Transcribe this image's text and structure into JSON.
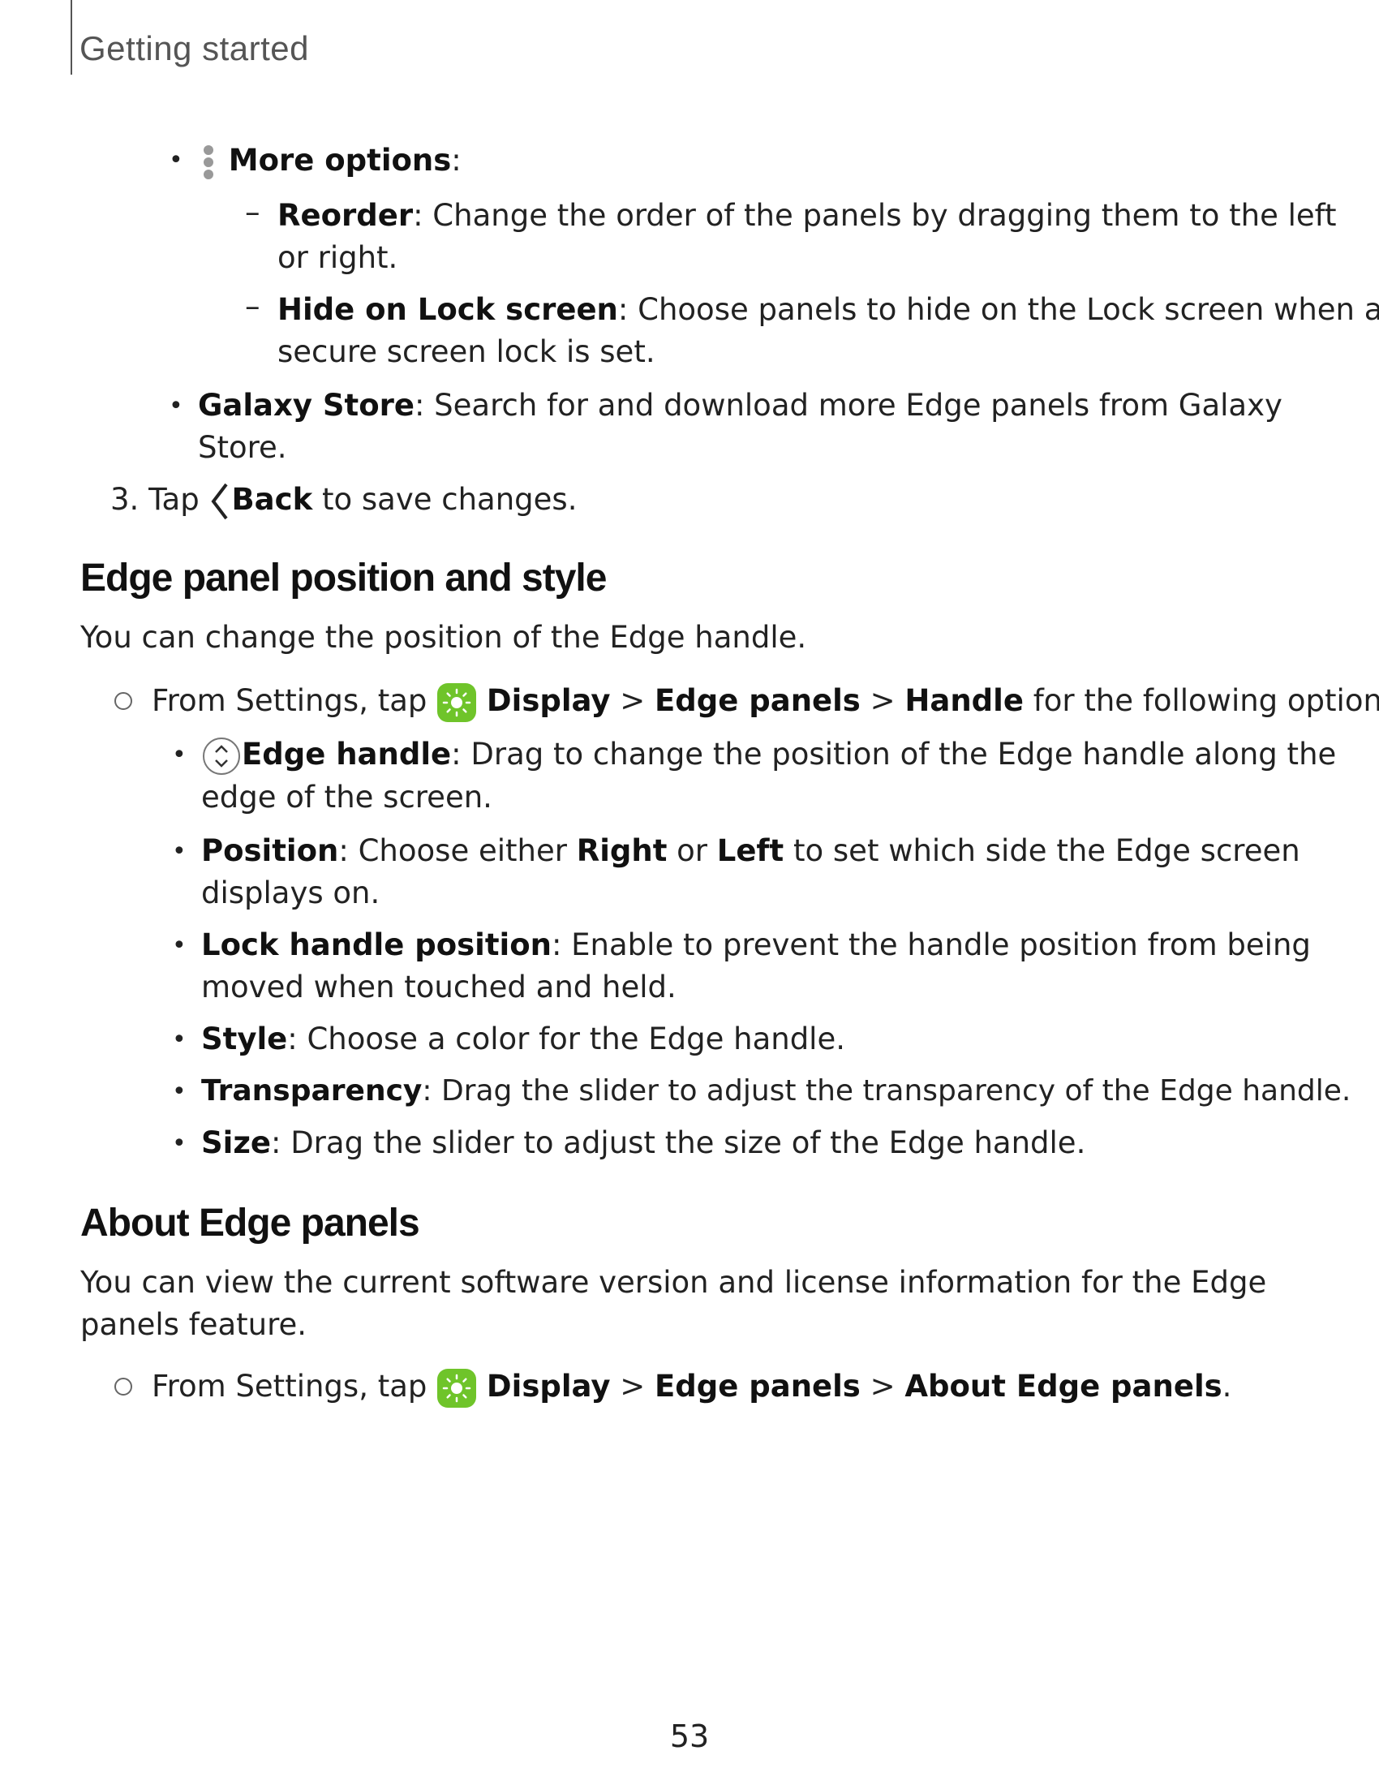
{
  "header": {
    "section": "Getting started"
  },
  "more_options": {
    "label": "More options",
    "colon": ":",
    "icon": "more-options-icon",
    "items": [
      {
        "term": "Reorder",
        "line1": ": Change the order of the panels by dragging them to the left",
        "line2": "or right."
      },
      {
        "term": "Hide on Lock screen",
        "line1": ": Choose panels to hide on the Lock screen when a",
        "line2": "secure screen lock is set."
      }
    ]
  },
  "galaxy_store": {
    "term": "Galaxy Store",
    "line1": ": Search for and download more Edge panels from Galaxy",
    "line2": "Store."
  },
  "step3": {
    "number": "3.",
    "tap": "Tap",
    "back": "Back",
    "rest": "to save changes.",
    "icon": "back-chevron-icon"
  },
  "section_position": {
    "heading": "Edge panel position and style",
    "intro": "You can change the position of the Edge handle.",
    "instruction": {
      "prefix": "From Settings, tap",
      "display": "Display",
      "sep": ">",
      "edge_panels": "Edge panels",
      "handle": "Handle",
      "suffix": "for the following options:",
      "icon": "display-settings-icon"
    },
    "options": [
      {
        "term": "Edge handle",
        "line1": ": Drag to change the position of the Edge handle along the",
        "line2": "edge of the screen.",
        "icon": "edge-handle-icon"
      },
      {
        "term": "Position",
        "p1": ": Choose either ",
        "right": "Right",
        "or": " or ",
        "left": "Left",
        "p2": " to set which side the Edge screen",
        "line2": "displays on."
      },
      {
        "term": "Lock handle position",
        "line1": ": Enable to prevent the handle position from being",
        "line2": "moved when touched and held."
      },
      {
        "term": "Style",
        "line1": ": Choose a color for the Edge handle."
      },
      {
        "term": "Transparency",
        "line1": ": Drag the slider to adjust the transparency of the Edge handle."
      },
      {
        "term": "Size",
        "line1": ": Drag the slider to adjust the size of the Edge handle."
      }
    ]
  },
  "section_about": {
    "heading": "About Edge panels",
    "intro_line1": "You can view the current software version and license information for the Edge",
    "intro_line2": "panels feature.",
    "instruction": {
      "prefix": "From Settings, tap",
      "display": "Display",
      "sep": ">",
      "edge_panels": "Edge panels",
      "about": "About Edge panels",
      "end": "."
    }
  },
  "footer": {
    "page_number": "53"
  },
  "colors": {
    "display_icon_bg": "#6fc42a",
    "text": "#222222"
  }
}
